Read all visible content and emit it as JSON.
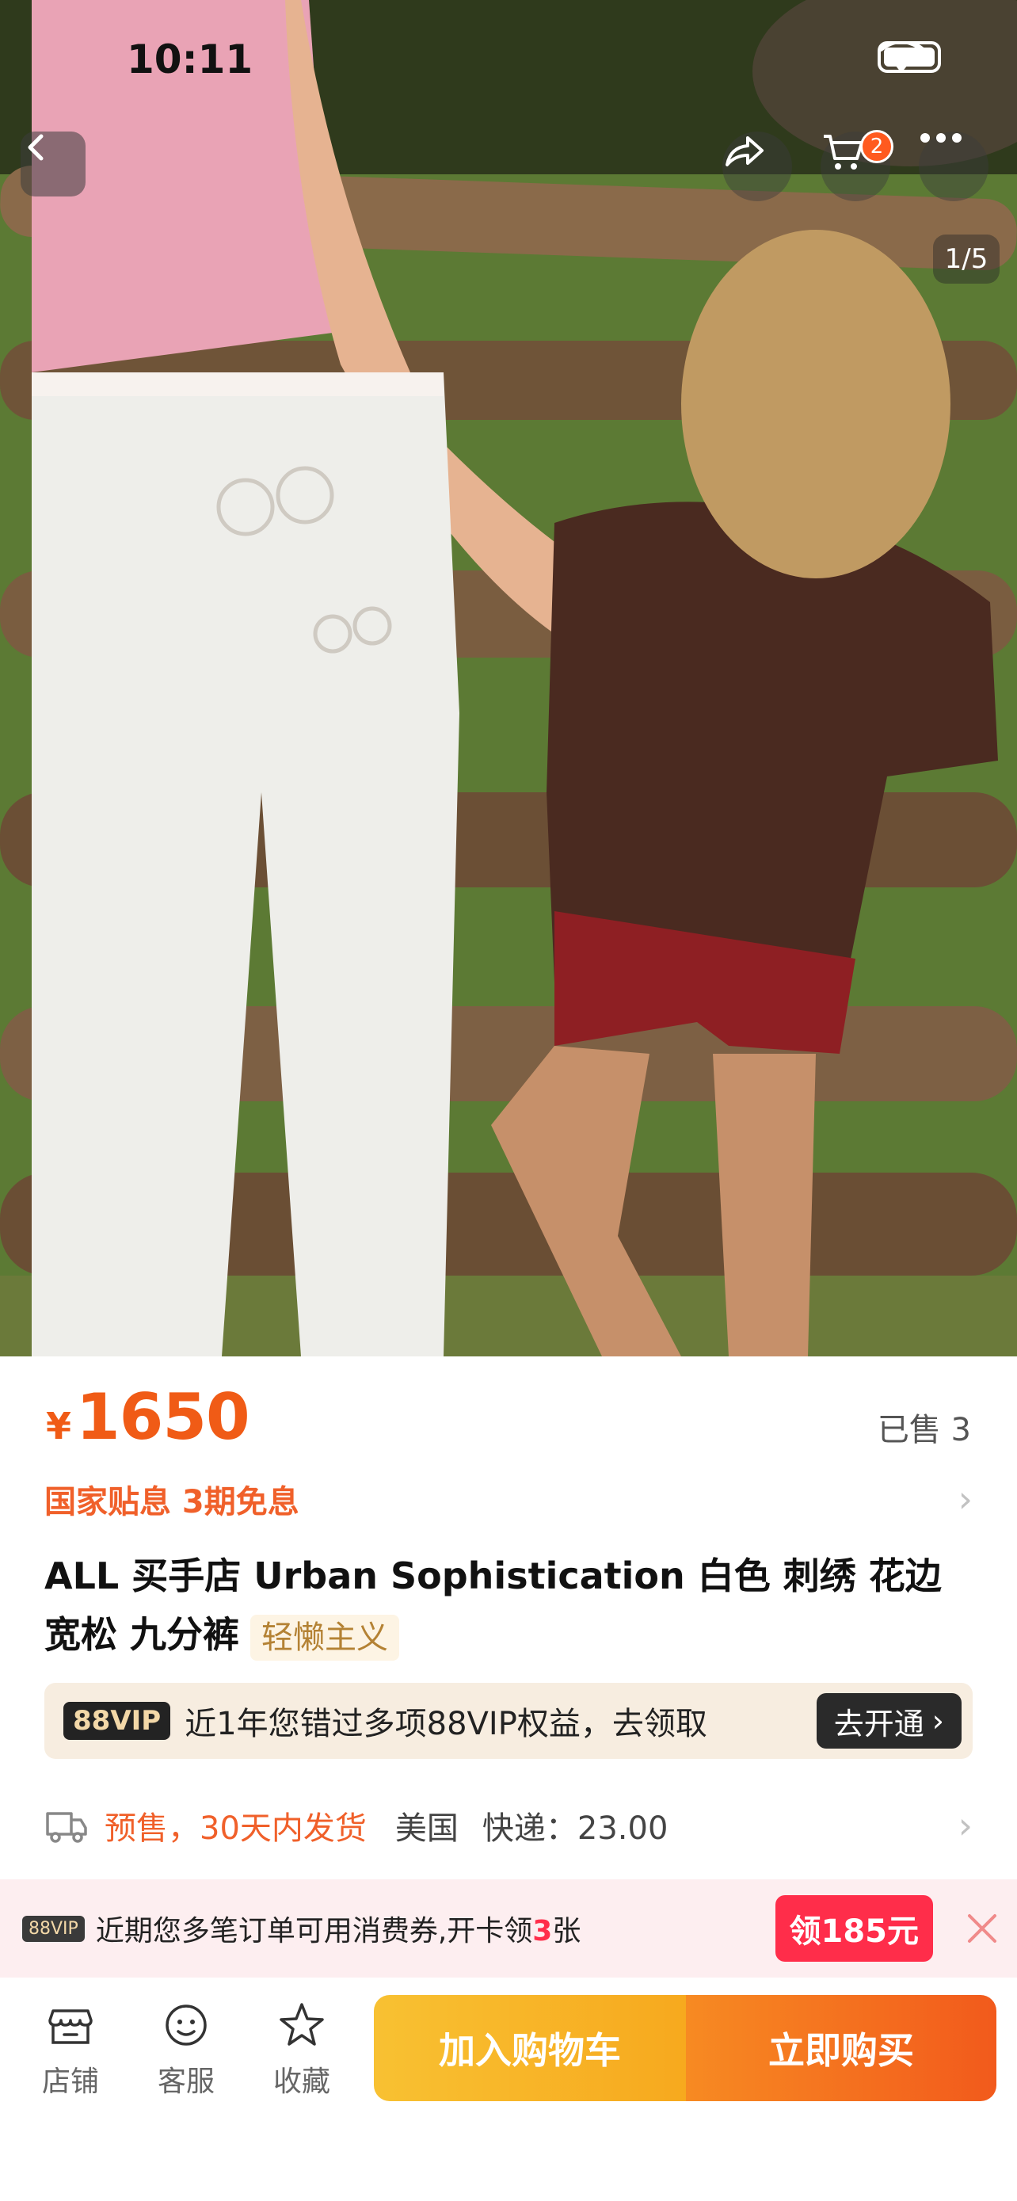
{
  "status_bar": {
    "time": "10:11"
  },
  "gallery": {
    "counter": "1/5",
    "cart_badge": "2"
  },
  "product": {
    "currency": "¥",
    "price": "1650",
    "sold": "已售 3",
    "subsidy": "国家贴息 3期免息",
    "title": "ALL 买手店 Urban Sophistication 白色 刺绣 花边 宽松 九分裤",
    "tag": "轻懒主义"
  },
  "vip_banner": {
    "logo": "88VIP",
    "text": "近1年您错过多项88VIP权益，去领取",
    "button": "去开通"
  },
  "shipping": {
    "presale": "预售，30天内发货",
    "origin": "美国",
    "fee": "快递：23.00"
  },
  "coupon": {
    "logo": "88VIP",
    "text_before": "近期您多笔订单可用消费券,开卡领",
    "count": "3",
    "text_after": "张",
    "button": "领185元"
  },
  "bottom_bar": {
    "store": "店铺",
    "service": "客服",
    "favorite": "收藏",
    "add_to_cart": "加入购物车",
    "buy_now": "立即购买"
  },
  "colors": {
    "price_orange": "#f05b16",
    "cart_yellow": "#f8c132",
    "buy_orange": "#f25a1c",
    "coupon_red": "#ff2d4a"
  }
}
